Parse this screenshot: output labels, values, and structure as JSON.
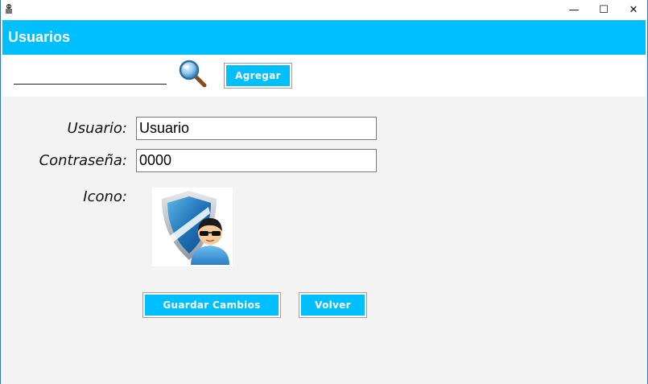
{
  "window": {
    "minimize_glyph": "—",
    "maximize_glyph": "☐",
    "close_glyph": "✕"
  },
  "header": {
    "title": "Usuarios",
    "accent_color": "#00bfff"
  },
  "toolbar": {
    "search_value": "",
    "add_label": "Agregar"
  },
  "form": {
    "usuario_label": "Usuario:",
    "usuario_value": "Usuario",
    "password_label": "Contraseña:",
    "password_value": "0000",
    "icon_label": "Icono:",
    "icon_name": "shield-user-icon"
  },
  "actions": {
    "save_label": "Guardar Cambios",
    "back_label": "Volver"
  }
}
